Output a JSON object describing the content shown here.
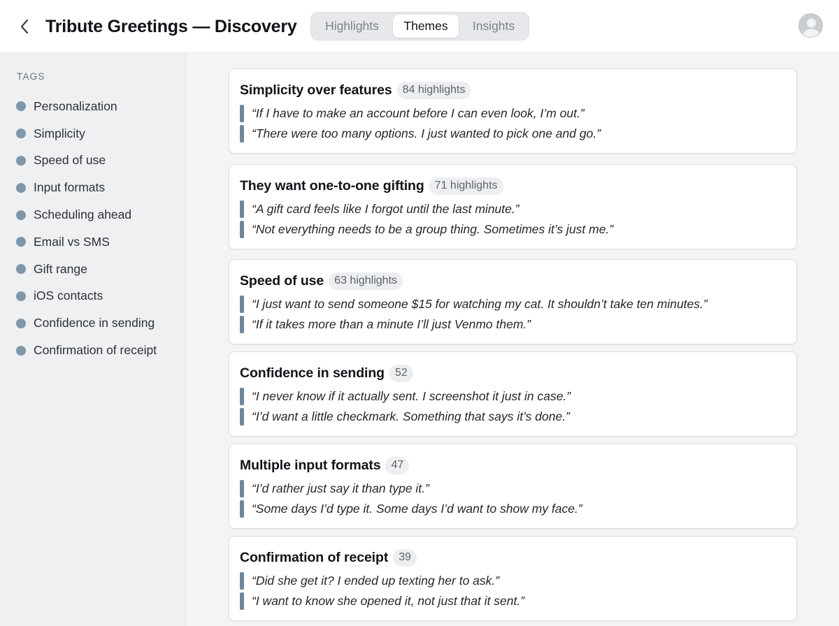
{
  "header": {
    "title": "Tribute Greetings — Discovery",
    "tabs": [
      {
        "label": "Highlights",
        "active": false
      },
      {
        "label": "Themes",
        "active": true
      },
      {
        "label": "Insights",
        "active": false
      }
    ],
    "back_icon": "chevron-left-icon",
    "avatar_icon": "user-avatar-icon"
  },
  "sidebar": {
    "heading": "TAGS",
    "dot_color": "#7f97aa",
    "tags": [
      {
        "label": "Personalization"
      },
      {
        "label": "Simplicity"
      },
      {
        "label": "Speed of use"
      },
      {
        "label": "Input formats"
      },
      {
        "label": "Scheduling ahead"
      },
      {
        "label": "Email vs SMS"
      },
      {
        "label": "Gift range"
      },
      {
        "label": "iOS contacts"
      },
      {
        "label": "Confidence in sending"
      },
      {
        "label": "Confirmation of receipt"
      }
    ]
  },
  "themes": [
    {
      "title": "Simplicity over features",
      "count": "84 highlights",
      "quotes": [
        "“If I have to make an account before I can even look, I’m out.”",
        "“There were too many options. I just wanted to pick one and go.”"
      ]
    },
    {
      "title": "They want one-to-one gifting",
      "count": "71 highlights",
      "quotes": [
        "“A gift card feels like I forgot until the last minute.”",
        "“Not everything needs to be a group thing. Sometimes it’s just me.”"
      ]
    },
    {
      "title": "Speed of use",
      "count": "63 highlights",
      "quotes": [
        "“I just want to send someone $15 for watching my cat. It shouldn’t take ten minutes.”",
        "“If it takes more than a minute I’ll just Venmo them.”"
      ]
    },
    {
      "title": "Confidence in sending",
      "count": "52",
      "quotes": [
        "“I never know if it actually sent. I screenshot it just in case.”",
        "“I’d want a little checkmark. Something that says it’s done.”"
      ]
    },
    {
      "title": "Multiple input formats",
      "count": "47",
      "quotes": [
        "“I’d rather just say it than type it.”",
        "“Some days I’d type it. Some days I’d want to show my face.”"
      ]
    },
    {
      "title": "Confirmation of receipt",
      "count": "39",
      "quotes": [
        "“Did she get it? I ended up texting her to ask.”",
        "“I want to know she opened it, not just that it sent.”"
      ]
    }
  ],
  "colors": {
    "accent_bar": "#6f8799",
    "background": "#f3f4f6",
    "sidebar_bg": "#eef0f2"
  }
}
